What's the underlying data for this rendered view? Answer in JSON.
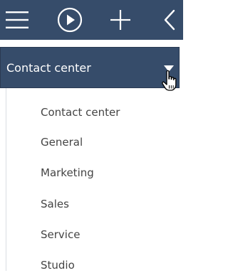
{
  "toolbar": {
    "icons": [
      "hamburger-menu-icon",
      "play-circle-icon",
      "plus-icon",
      "chevron-left-icon"
    ],
    "background": "#364c6a",
    "icon_color": "#ffffff"
  },
  "section_selector": {
    "selected_value": "Contact center",
    "caret_icon": "caret-down-icon"
  },
  "section_menu": {
    "items": [
      {
        "label": "Contact center"
      },
      {
        "label": "General"
      },
      {
        "label": "Marketing"
      },
      {
        "label": "Sales"
      },
      {
        "label": "Service"
      },
      {
        "label": "Studio"
      }
    ],
    "text_color": "#444444"
  },
  "cursor": {
    "icon": "hand-pointer-cursor-icon"
  }
}
